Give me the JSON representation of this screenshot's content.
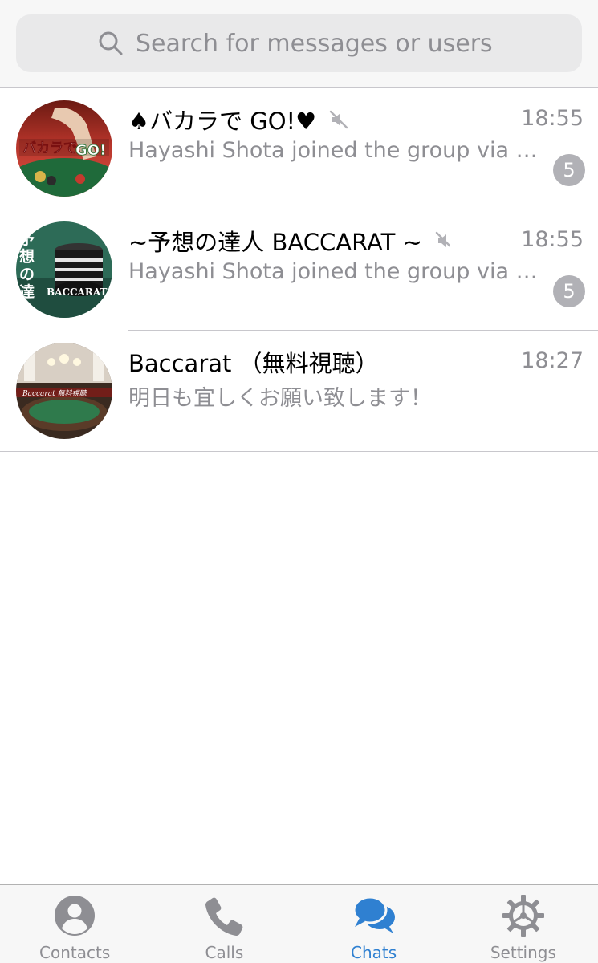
{
  "search": {
    "placeholder": "Search for messages or users",
    "icon": "search-icon"
  },
  "chats": [
    {
      "title": "♠バカラで GO!♥",
      "muted": true,
      "time": "18:55",
      "preview": "Hayashi Shota joined the group via i...",
      "unread": "5",
      "avatar_text": "バカラでGO!"
    },
    {
      "title": "~予想の達人 BACCARAT ~",
      "muted": true,
      "time": "18:55",
      "preview": "Hayashi Shota joined the group via i...",
      "unread": "5",
      "avatar_text": [
        "予想の達人",
        "BACCARAT"
      ]
    },
    {
      "title": "Baccarat （無料視聴）",
      "muted": false,
      "time": "18:27",
      "preview": "明日も宜しくお願い致します！",
      "unread": null,
      "avatar_text": "Baccarat 無料視聴"
    }
  ],
  "tabs": [
    {
      "label": "Contacts",
      "icon": "contacts-icon",
      "active": false
    },
    {
      "label": "Calls",
      "icon": "phone-icon",
      "active": false
    },
    {
      "label": "Chats",
      "icon": "chats-icon",
      "active": true
    },
    {
      "label": "Settings",
      "icon": "gear-icon",
      "active": false
    }
  ],
  "colors": {
    "accent": "#2f80d1",
    "inactive": "#8e8e93",
    "badge": "#b1b1b6",
    "separator": "#c8c7cc"
  }
}
